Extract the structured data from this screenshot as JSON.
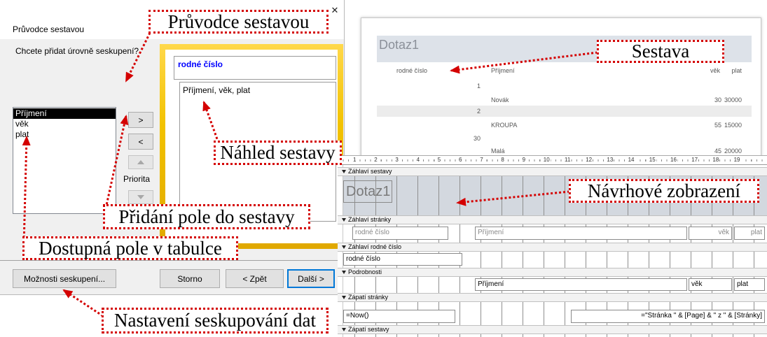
{
  "wizard": {
    "title": "Průvodce sestavou",
    "question": "Chcete přidat úrovně seskupení?",
    "fields": [
      {
        "label": "Příjmení",
        "selected": true
      },
      {
        "label": "věk",
        "selected": false
      },
      {
        "label": "plat",
        "selected": false
      }
    ],
    "add_button": ">",
    "remove_button": "<",
    "priority_label": "Priorita",
    "preview": {
      "group_field": "rodné číslo",
      "detail_fields": "Příjmení, věk, plat"
    },
    "buttons": {
      "options": "Možnosti seskupení...",
      "cancel": "Storno",
      "back": "< Zpět",
      "next": "Další >"
    },
    "icons": {
      "close": "close-icon",
      "priority_up": "arrow-up-icon",
      "priority_down": "arrow-down-icon"
    }
  },
  "report": {
    "title": "Dotaz1",
    "headers": {
      "rc": "rodné číslo",
      "surname": "Příjmení",
      "age": "věk",
      "salary": "plat"
    },
    "rows": [
      {
        "rc": "1"
      },
      {
        "surname": "Novák",
        "age": "30",
        "salary": "30000"
      },
      {
        "rc": "2"
      },
      {
        "surname": "KROUPA",
        "age": "55",
        "salary": "15000"
      },
      {
        "rc": "30"
      },
      {
        "surname": "Malá",
        "age": "45",
        "salary": "20000"
      }
    ]
  },
  "design": {
    "ruler": [
      "1",
      "2",
      "3",
      "4",
      "5",
      "6",
      "7",
      "8",
      "9",
      "10",
      "11",
      "12",
      "13",
      "14",
      "15",
      "16",
      "17",
      "18",
      "19"
    ],
    "sections": {
      "report_header": "Záhlaví sestavy",
      "page_header": "Záhlaví stránky",
      "group_header": "Záhlaví rodné číslo",
      "detail": "Podrobnosti",
      "page_footer": "Zápatí stránky",
      "report_footer": "Zápatí sestavy"
    },
    "report_header": {
      "title": "Dotaz1"
    },
    "page_header": {
      "rc": "rodné číslo",
      "surname": "Příjmení",
      "age": "věk",
      "salary": "plat"
    },
    "group_header": {
      "rc": "rodné číslo"
    },
    "detail": {
      "surname": "Příjmení",
      "age": "věk",
      "salary": "plat"
    },
    "page_footer": {
      "date": "=Now()",
      "page": "=\"Stránka \" & [Page] & \" z \" & [Stránky]"
    }
  },
  "callouts": {
    "wizard": "Průvodce sestavou",
    "report": "Sestava",
    "preview": "Náhled sestavy",
    "add_field": "Přidání pole do sestavy",
    "available_fields": "Dostupná pole v tabulce",
    "design_view": "Návrhové zobrazení",
    "grouping_options": "Nastavení seskupování dat"
  },
  "colors": {
    "callout": "#d40000",
    "accent": "#0078d7",
    "gold": "#f2c200",
    "group": "#0000ff"
  }
}
